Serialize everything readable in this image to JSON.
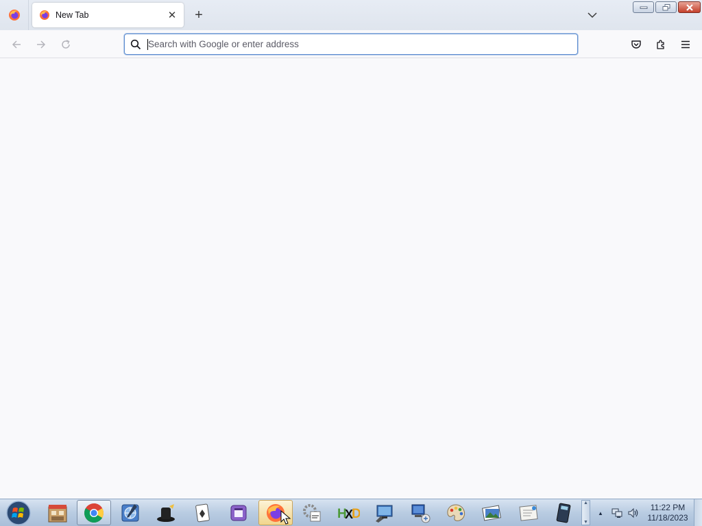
{
  "browser": {
    "tabs": [
      {
        "title": "New Tab",
        "close_glyph": "✕"
      }
    ],
    "new_tab_glyph": "+",
    "address_bar": {
      "value": "",
      "placeholder": "Search with Google or enter address"
    },
    "nav_buttons": [
      "back",
      "forward",
      "reload"
    ],
    "toolbar_icons": [
      "pocket-icon",
      "extensions-icon",
      "app-menu-icon"
    ]
  },
  "taskbar": {
    "pinned_apps": [
      "file-manager",
      "chrome",
      "network-tool",
      "top-hat-app",
      "solitaire",
      "purple-app",
      "firefox",
      "settings-app",
      "hxd-hex-editor",
      "remote-desktop",
      "network-connection",
      "paint-palette",
      "photo-viewer",
      "notepad-document",
      "calculator"
    ],
    "tray_arrow": "▲",
    "clock": {
      "time": "11:22 PM",
      "date": "11/18/2023"
    }
  },
  "colors": {
    "content_bg": "#f9f9fb",
    "urlbar_focus": "#5b8bd0",
    "taskbar": "#b9cce2"
  }
}
